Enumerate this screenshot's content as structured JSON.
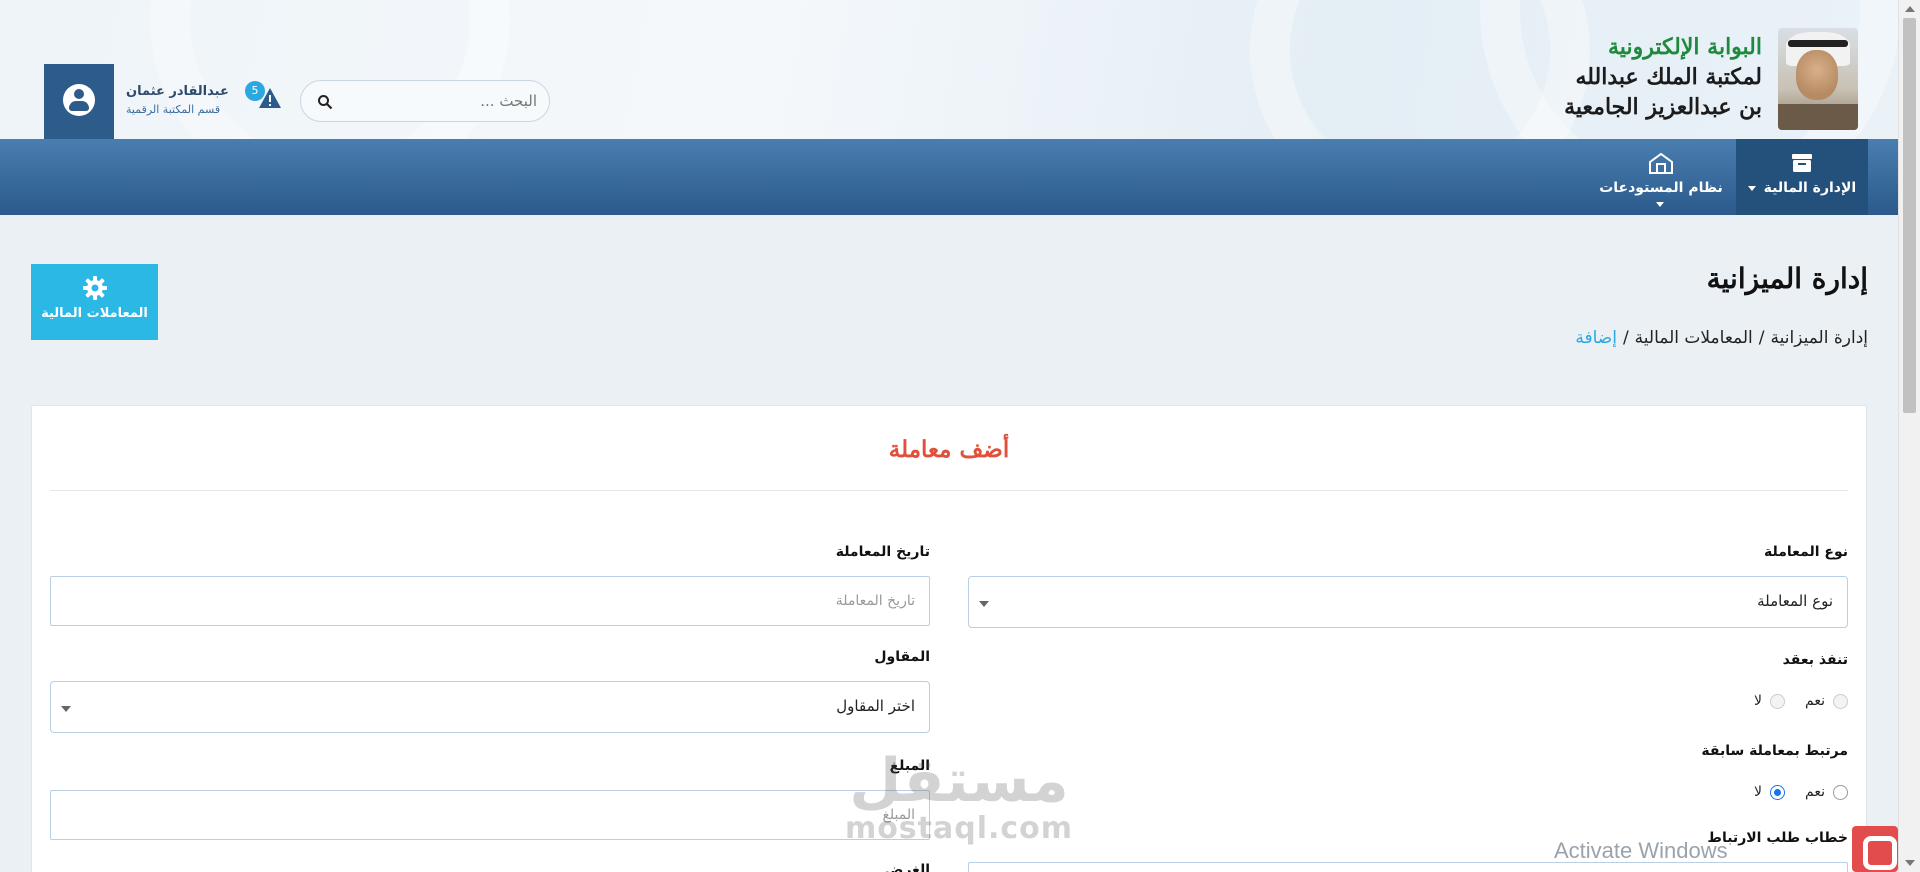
{
  "header": {
    "logo_line1": "البوابة الإلكترونية",
    "logo_line2": "لمكتبة الملك عبدالله",
    "logo_line3": "بن عبدالعزيز الجامعية",
    "user_name": "عبدالقادر عثمان",
    "user_dept": "قسم المكتبة الرقمية",
    "notification_count": "5",
    "search_placeholder": "البحث ..."
  },
  "nav": {
    "items": [
      {
        "label": "الإدارة المالية",
        "icon": "archive-box-icon",
        "active": true
      },
      {
        "label": "نظام المستودعات",
        "icon": "warehouse-icon",
        "active": false
      }
    ]
  },
  "page": {
    "title": "إدارة الميزانية",
    "breadcrumb": [
      "إدارة الميزانية",
      "المعاملات المالية",
      "إضافة"
    ],
    "side_button_label": "المعاملات المالية",
    "side_button_icon": "gear-icon"
  },
  "form": {
    "title": "أضف معاملة",
    "transaction_type_label": "نوع المعاملة",
    "transaction_type_value": "نوع المعاملة",
    "transaction_date_label": "تاريخ المعاملة",
    "transaction_date_placeholder": "تاريخ المعاملة",
    "contract_label": "تنفذ بعقد",
    "yes": "نعم",
    "no": "لا",
    "contractor_label": "المقاول",
    "contractor_value": "اختر المقاول",
    "linked_label": "مرتبط بمعاملة سابقة",
    "linked_selected": "لا",
    "amount_label": "المبلغ",
    "amount_placeholder": "المبلغ",
    "link_letter_label": "خطاب طلب الارتباط",
    "purpose_label": "الغرض"
  },
  "overlay": {
    "watermark_ar": "مستقل",
    "watermark_en": "mostaql.com",
    "activate_windows": "Activate Windows"
  },
  "colors": {
    "navbar": "#2b5a8b",
    "accent": "#2bb8e5",
    "form_title": "#e0503a",
    "logo_green": "#1f8a3d"
  }
}
